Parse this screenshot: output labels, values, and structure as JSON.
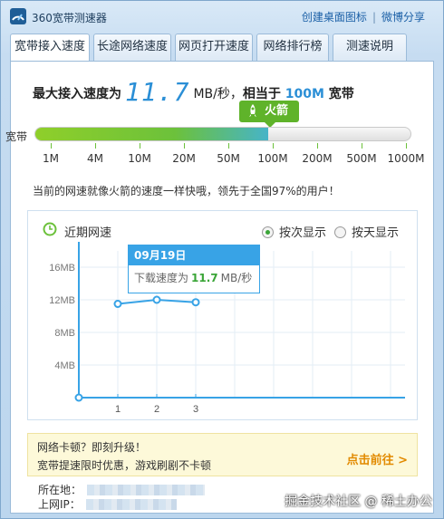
{
  "window": {
    "title": "360宽带测速器",
    "links": [
      "创建桌面图标",
      "微博分享"
    ]
  },
  "tabs": [
    {
      "label": "宽带接入速度",
      "active": true
    },
    {
      "label": "长途网络速度",
      "active": false
    },
    {
      "label": "网页打开速度",
      "active": false
    },
    {
      "label": "网络排行榜",
      "active": false
    },
    {
      "label": "测速说明",
      "active": false
    }
  ],
  "summary": {
    "prefix": "最大接入速度为",
    "speed": "11.7",
    "unit": "MB/秒，",
    "equiv_prefix": "相当于",
    "equiv": "100M",
    "equiv_suffix": "宽带"
  },
  "badge": {
    "label": "火箭",
    "icon": "rocket-icon"
  },
  "speed_bar": {
    "label": "宽带",
    "ticks": [
      "1M",
      "4M",
      "10M",
      "20M",
      "50M",
      "100M",
      "200M",
      "500M",
      "1000M"
    ],
    "fill_fraction": 0.62
  },
  "description": "当前的网速就像火箭的速度一样快哦，领先于全国97%的用户！",
  "chart_panel": {
    "title": "近期网速",
    "radio_options": [
      {
        "label": "按次显示",
        "selected": true
      },
      {
        "label": "按天显示",
        "selected": false
      }
    ],
    "tooltip": {
      "date": "09月19日",
      "prefix": "下载速度为",
      "value": "11.7",
      "unit": "MB/秒"
    }
  },
  "chart_data": {
    "type": "line",
    "x": [
      1,
      2,
      3
    ],
    "series": [
      {
        "values": [
          11.5,
          12.0,
          11.7
        ]
      }
    ],
    "yticks": [
      "4MB",
      "8MB",
      "12MB",
      "16MB"
    ],
    "xticks": [
      "1",
      "2",
      "3"
    ],
    "ylim": [
      0,
      18
    ],
    "grid": true,
    "color": "#38a3e6"
  },
  "promo": {
    "line1": "网络卡顿？即刻升级！",
    "line2": "宽带提速限时优惠，游戏刷剧不卡顿",
    "action": "点击前往 >"
  },
  "footer": {
    "location_label": "所在地：",
    "ip_label": "上网IP："
  },
  "watermark": "掘金技术社区 @ 稀土办公",
  "colors": {
    "accent": "#2b8fd6",
    "green": "#5fb32a",
    "line": "#38a3e6",
    "promo_action": "#e28a00"
  }
}
